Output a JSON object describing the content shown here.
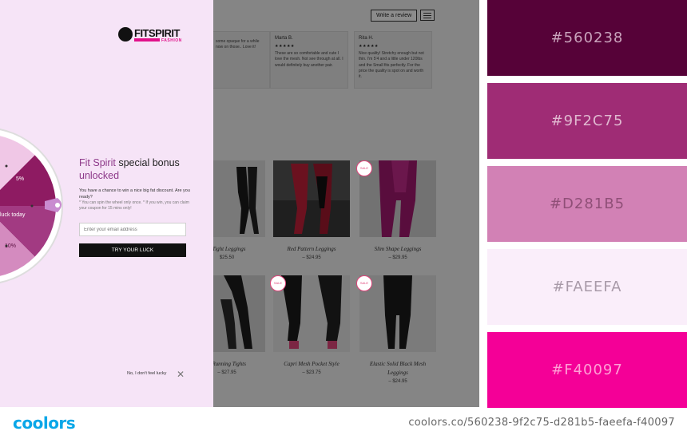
{
  "store": {
    "write_review": "Write a review",
    "reviews": [
      {
        "name": "",
        "stars": "",
        "text": "some opaque for a while now on those.. Love it!"
      },
      {
        "name": "Marta B.",
        "stars": "★★★★★",
        "text": "These are so comfortable and cute I love the mesh. Not see through at all. I would definitely buy another pair."
      },
      {
        "name": "Rita H.",
        "stars": "★★★★★",
        "text": "Nice quality! Stretchy enough but not thin. I'm 5'4 and a little under 120lbs and the Small fits perfectly. For the price the quality is spot on and worth it."
      }
    ],
    "products": [
      {
        "name": "h Tight Leggings",
        "price": "$25.50",
        "sale": ""
      },
      {
        "name": "Red Pattern Leggings",
        "price": "– $24.95",
        "sale": ""
      },
      {
        "name": "Slim Shape Leggings",
        "price": "– $29.95",
        "sale": "SALE"
      },
      {
        "name": "h Running Tights",
        "price": "– $27.95",
        "sale": ""
      },
      {
        "name": "Capri Mesh Pocket Style",
        "price": "– $23.75",
        "sale": "SALE"
      },
      {
        "name": "Elastic Solid Black Mesh Leggings",
        "price": "– $24.95",
        "sale": "SALE"
      }
    ]
  },
  "popup": {
    "logo_text": "FITSPIRIT",
    "logo_sub": "FASHION",
    "heading_accent": "Fit Spirit",
    "heading_dark": "special bonus",
    "heading_accent2": "unlocked",
    "copy1": "You have a chance to win a nice big fat discount. Are you ready?",
    "copy2": "* You can spin the wheel only once. * If you win, you can claim your coupon for 15 mins only!",
    "email_placeholder": "Enter your email address",
    "try_button": "TRY YOUR LUCK",
    "no_thanks": "No, I don't feel lucky",
    "close": "✕",
    "wheel_labels": [
      "5%",
      "luck today",
      "10%"
    ],
    "colors": {
      "panel": "#f6e4f7",
      "accent": "#8e3a8a",
      "button": "#111111"
    }
  },
  "palette": [
    {
      "hex": "#560238",
      "label": "#560238",
      "text_color": "#c9a3bc"
    },
    {
      "hex": "#9F2C75",
      "label": "#9F2C75",
      "text_color": "#e0b8d0"
    },
    {
      "hex": "#D281B5",
      "label": "#D281B5",
      "text_color": "#8f4f77"
    },
    {
      "hex": "#FAEEFA",
      "label": "#FAEEFA",
      "text_color": "#a89aa8"
    },
    {
      "hex": "#F40097",
      "label": "#F40097",
      "text_color": "#ff9fd6"
    }
  ],
  "footer": {
    "brand": "coolors",
    "url": "coolors.co/560238-9f2c75-d281b5-faeefa-f40097"
  }
}
